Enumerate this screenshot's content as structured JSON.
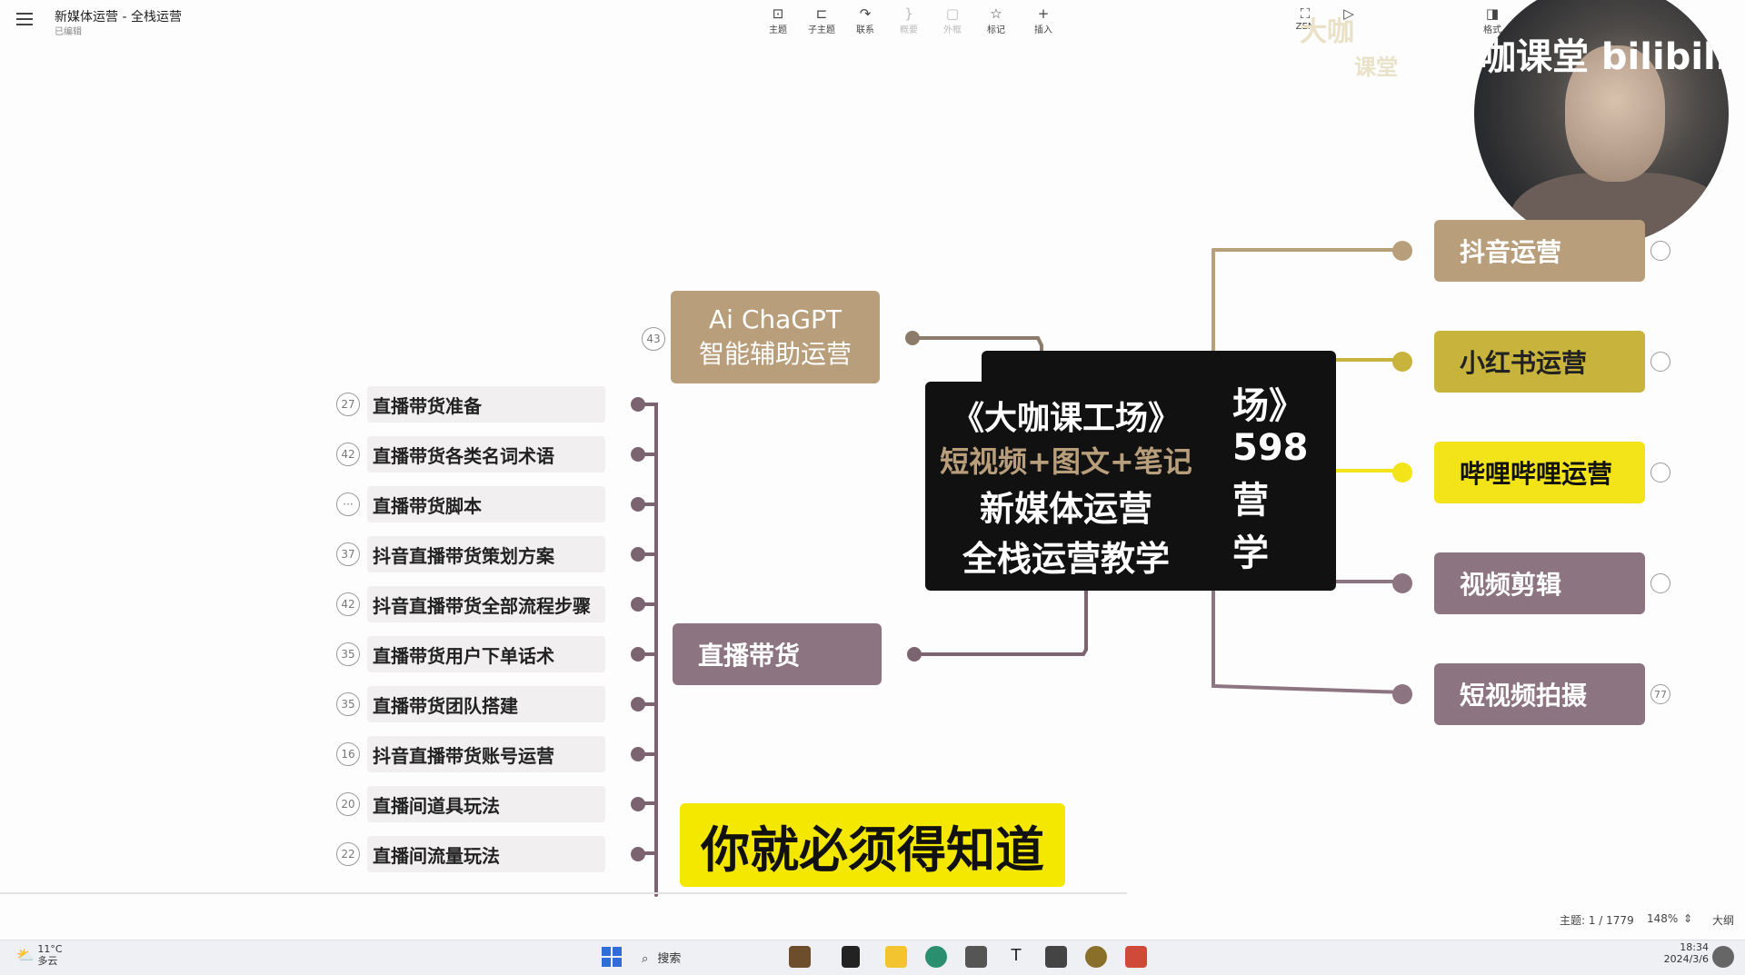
{
  "header": {
    "title": "新媒体运营 - 全栈运营",
    "subtitle": "已编辑",
    "tools": [
      {
        "label": "主题",
        "icon": "topic-icon",
        "glyph": "⊡"
      },
      {
        "label": "子主题",
        "icon": "subtopic-icon",
        "glyph": "⊏"
      },
      {
        "label": "联系",
        "icon": "relation-icon",
        "glyph": "↷"
      },
      {
        "label": "概要",
        "icon": "summary-icon",
        "glyph": "}"
      },
      {
        "label": "外框",
        "icon": "boundary-icon",
        "glyph": "▢"
      },
      {
        "label": "标记",
        "icon": "marker-icon",
        "glyph": "☆"
      },
      {
        "label": "插入",
        "icon": "insert-icon",
        "glyph": "+"
      }
    ],
    "right_tools": [
      {
        "label": "ZEN",
        "icon": "zen-icon",
        "glyph": "⛶"
      },
      {
        "label": "",
        "icon": "play-icon",
        "glyph": "▷"
      },
      {
        "label": "格式",
        "icon": "format-icon",
        "glyph": "◨"
      }
    ]
  },
  "watermark": {
    "line1": "大咖",
    "line2": "课堂"
  },
  "webcam": {
    "overlay_text": "咖课堂 bilibili"
  },
  "center": {
    "line1": "《大咖课工场》",
    "line2": "短视频+图文+笔记",
    "line3": "新媒体运营",
    "line4": "全栈运营教学",
    "peek1": "场》",
    "peek2": "598",
    "peek3": "营",
    "peek4": "学"
  },
  "left_nodes": [
    {
      "label": "Ai ChaGPT",
      "label2": "智能辅助运营",
      "badge": "43"
    },
    {
      "label": "直播带货"
    }
  ],
  "sub_topics": [
    {
      "label": "直播带货准备",
      "badge": "27"
    },
    {
      "label": "直播带货各类名词术语",
      "badge": "42"
    },
    {
      "label": "直播带货脚本",
      "badge": "···"
    },
    {
      "label": "抖音直播带货策划方案",
      "badge": "37"
    },
    {
      "label": "抖音直播带货全部流程步骤",
      "badge": "42"
    },
    {
      "label": "直播带货用户下单话术",
      "badge": "35"
    },
    {
      "label": "直播带货团队搭建",
      "badge": "35"
    },
    {
      "label": "抖音直播带货账号运营",
      "badge": "16"
    },
    {
      "label": "直播间道具玩法",
      "badge": "20"
    },
    {
      "label": "直播间流量玩法",
      "badge": "22"
    }
  ],
  "right_nodes": [
    {
      "label": "抖音运营",
      "color": "#b89e7a",
      "text_color": "#ffffff",
      "badge": ""
    },
    {
      "label": "小红书运营",
      "color": "#c8b43c",
      "text_color": "#222222",
      "badge": ""
    },
    {
      "label": "哔哩哔哩运营",
      "color": "#f3e41a",
      "text_color": "#111111",
      "badge": ""
    },
    {
      "label": "视频剪辑",
      "color": "#8c7480",
      "text_color": "#ffffff",
      "badge": ""
    },
    {
      "label": "短视频拍摄",
      "color": "#8c7480",
      "text_color": "#ffffff",
      "badge": "77"
    }
  ],
  "caption": "你就必须得知道",
  "status": {
    "topic_count": "主题: 1 / 1779",
    "zoom": "148%",
    "outline": "大纲"
  },
  "taskbar": {
    "weather_temp": "11°C",
    "weather_desc": "多云",
    "search": "搜索",
    "time": "18:34",
    "date": "2024/3/6"
  }
}
